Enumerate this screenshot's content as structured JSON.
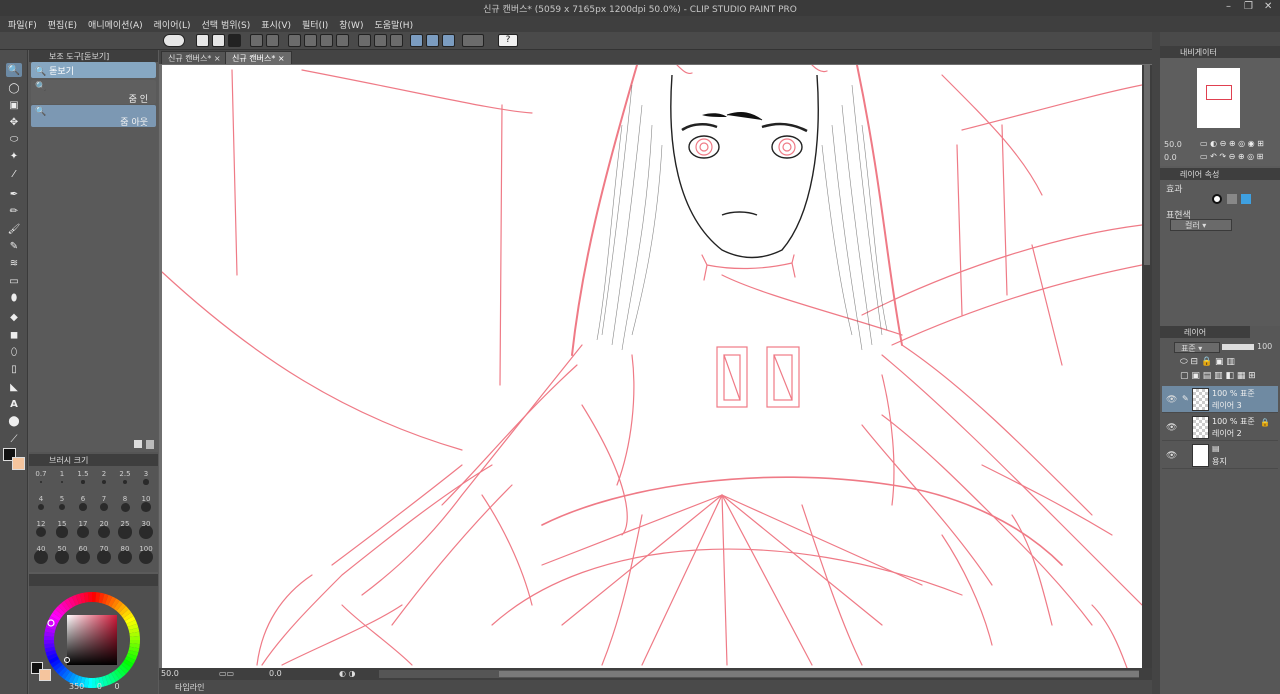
{
  "window": {
    "title": "신규 캔버스* (5059 x 7165px 1200dpi 50.0%) - CLIP STUDIO PAINT PRO"
  },
  "menu": [
    "파일(F)",
    "편집(E)",
    "애니메이션(A)",
    "레이어(L)",
    "선택 범위(S)",
    "표시(V)",
    "필터(I)",
    "창(W)",
    "도움말(H)"
  ],
  "subtool": {
    "tab_label": "보조 도구[돋보기]",
    "group_label": "돋보기",
    "items": [
      "줌 인",
      "줌 아웃"
    ]
  },
  "brush": {
    "tab_label": "브러시 크기",
    "sizes": [
      "0.7",
      "1",
      "1.5",
      "2",
      "2.5",
      "3",
      "4",
      "5",
      "6",
      "7",
      "8",
      "10",
      "12",
      "15",
      "17",
      "20",
      "25",
      "30",
      "40",
      "50",
      "60",
      "70",
      "80",
      "100"
    ]
  },
  "color": {
    "main": "#111111",
    "sub": "#f5c59e",
    "readout": "350",
    "readout_b": "0",
    "readout_c": "0"
  },
  "canvas": {
    "tabs": [
      "신규 캔버스*",
      "신규 캔버스*"
    ],
    "zoom": "50.0",
    "rotate": "0.0",
    "sketch_color": "#ef7a86"
  },
  "timeline": {
    "label": "타임라인"
  },
  "navigator": {
    "tab_label": "내비게이터",
    "zoom": "50.0",
    "rotate": "0.0"
  },
  "effect": {
    "tab_label": "레이어 속성",
    "effect_label": "효과",
    "expression_label": "표현색",
    "expression_value": "컬러"
  },
  "layers": {
    "tab_label": "레이어",
    "blend": "표준",
    "opacity": "100",
    "rows": [
      {
        "mode": "100 % 표준",
        "name": "레이어 3",
        "selected": true
      },
      {
        "mode": "100 % 표준",
        "name": "레이어 2",
        "selected": false
      },
      {
        "mode": "",
        "name": "용지",
        "selected": false
      }
    ]
  }
}
